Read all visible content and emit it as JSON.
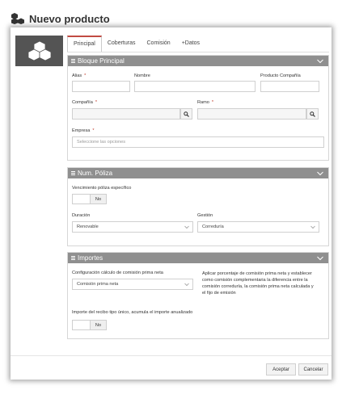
{
  "window": {
    "title": "Nuevo producto"
  },
  "tabs": [
    {
      "label": "Principal"
    },
    {
      "label": "Coberturas"
    },
    {
      "label": "Comisión"
    },
    {
      "label": "+Datos"
    }
  ],
  "sections": {
    "principal": {
      "title": "Bloque Principal",
      "alias_label": "Alias",
      "alias_value": "",
      "nombre_label": "Nombre",
      "nombre_value": "",
      "producto_compania_label": "Producto Compañía",
      "producto_compania_value": "",
      "compania_label": "Compañía",
      "compania_value": "",
      "ramo_label": "Ramo",
      "ramo_value": "",
      "empresa_label": "Empresa",
      "empresa_placeholder": "Seleccione las opciones",
      "required_mark": "*"
    },
    "poliza": {
      "title": "Num. Póliza",
      "vencimiento_label": "Vencimiento póliza específico",
      "vencimiento_toggle": "No",
      "duracion_label": "Duración",
      "duracion_value": "Renovable",
      "gestion_label": "Gestión",
      "gestion_value": "Correduría"
    },
    "importes": {
      "title": "Importes",
      "config_label": "Configuración cálculo de comisión prima neta",
      "config_value": "Comisión prima neta",
      "config_note": "Aplicar porcentaje de comisión prima neta y establecer como comisión complementaria la diferencia entre la comisión correduría, la comisión prima neta calculada y el fijo de emisión",
      "importe_label": "Importe del recibo tipo único, acumula el importe anualizado",
      "importe_toggle": "No"
    }
  },
  "buttons": {
    "accept": "Aceptar",
    "cancel": "Cancelar"
  },
  "icons": {
    "title": "cubes-icon",
    "logo": "cubes-icon",
    "search": "search-icon",
    "collapse": "chevron-down-icon",
    "select": "chevron-down-icon"
  },
  "colors": {
    "section_header": "#8f8f8f",
    "logo_bg": "#545454",
    "active_tab_accent": "#c14a42",
    "required": "#c0392b"
  }
}
